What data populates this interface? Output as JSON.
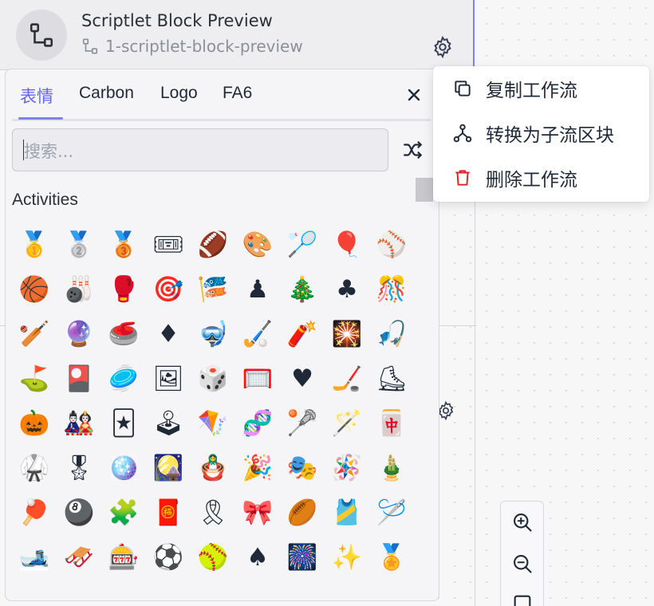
{
  "node": {
    "title": "Scriptlet Block Preview",
    "subtitle": "1-scriptlet-block-preview"
  },
  "picker": {
    "tabs": [
      {
        "label": "表情",
        "active": true
      },
      {
        "label": "Carbon",
        "active": false
      },
      {
        "label": "Logo",
        "active": false
      },
      {
        "label": "FA6",
        "active": false
      }
    ],
    "search_placeholder": "搜索...",
    "section_label": "Activities",
    "emojis": [
      "🥇",
      "🥈",
      "🥉",
      "🎟",
      "🏈",
      "🎨",
      "🏸",
      "🎈",
      "⚾",
      "🏀",
      "🎳",
      "🥊",
      "🎯",
      "🎏",
      "♟",
      "🎄",
      "♣",
      "🎊",
      "🏏",
      "🔮",
      "🥌",
      "♦",
      "🤿",
      "🏑",
      "🧨",
      "🎇",
      "🎣",
      "⛳",
      "🎴",
      "🥏",
      "🖼",
      "🎲",
      "🥅",
      "♥",
      "🏒",
      "⛸",
      "🎃",
      "🎎",
      "🃏",
      "🕹",
      "🪁",
      "🧬",
      "🥍",
      "🪄",
      "🀄",
      "🥋",
      "🎖",
      "🪩",
      "🎑",
      "🪆",
      "🎉",
      "🎭",
      "🪅",
      "🎍",
      "🏓",
      "🎱",
      "🧩",
      "🧧",
      "🎗",
      "🎀",
      "🏉",
      "🎽",
      "🪡",
      "🎿",
      "🛷",
      "🎰",
      "⚽",
      "🥎",
      "♠",
      "🎆",
      "✨",
      "🏅"
    ]
  },
  "menu": {
    "items": [
      {
        "label": "复制工作流",
        "icon": "copy-icon"
      },
      {
        "label": "转换为子流区块",
        "icon": "hierarchy-icon"
      },
      {
        "label": "删除工作流",
        "icon": "trash-icon"
      }
    ]
  },
  "colors": {
    "accent": "#6366f1",
    "danger": "#dc2626"
  }
}
